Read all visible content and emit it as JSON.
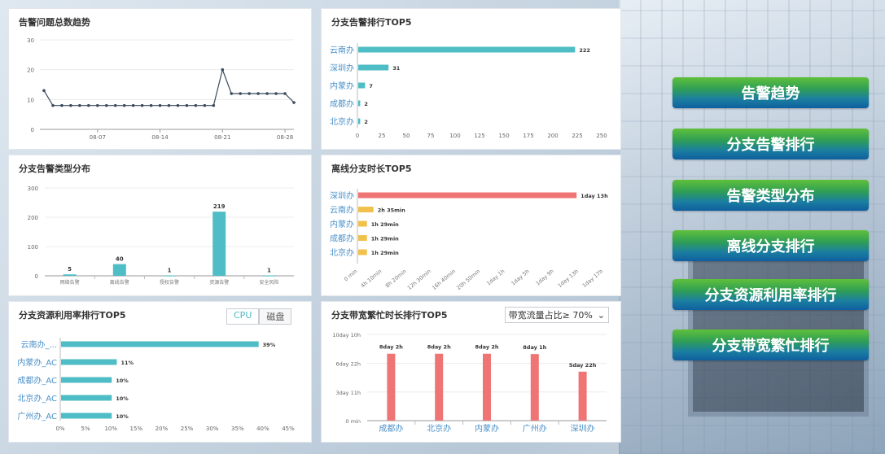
{
  "panels": {
    "trend": {
      "title": "告警问题总数趋势",
      "chart_data": {
        "type": "line",
        "y_ticks": [
          0,
          10,
          20,
          30
        ],
        "ylim": [
          0,
          30
        ],
        "x_tick_labels": [
          "08-07",
          "08-14",
          "08-21",
          "08-28"
        ],
        "x_tick_index": [
          6,
          13,
          20,
          27
        ],
        "values": [
          13,
          8,
          8,
          8,
          8,
          8,
          8,
          8,
          8,
          8,
          8,
          8,
          8,
          8,
          8,
          8,
          8,
          8,
          8,
          8,
          20,
          12,
          12,
          12,
          12,
          12,
          12,
          12,
          9
        ],
        "color": "#3a4a5e"
      }
    },
    "branch_alarm": {
      "title": "分支告警排行TOP5",
      "chart_data": {
        "type": "bar",
        "orientation": "horizontal",
        "categories": [
          "云南办",
          "深圳办",
          "内蒙办",
          "成都办",
          "北京办"
        ],
        "values": [
          222,
          31,
          7,
          2,
          2
        ],
        "value_labels": [
          "222",
          "31",
          "7",
          "2",
          "2"
        ],
        "x_ticks": [
          0,
          25,
          50,
          75,
          100,
          125,
          150,
          175,
          200,
          225,
          250
        ],
        "xlim": [
          0,
          250
        ],
        "color": "#4fbdc5"
      }
    },
    "alarm_type": {
      "title": "分支告警类型分布",
      "chart_data": {
        "type": "bar",
        "categories": [
          "网络告警",
          "离线告警",
          "授权告警",
          "资源告警",
          "安全风险"
        ],
        "values": [
          5,
          40,
          1,
          219,
          1
        ],
        "value_labels": [
          "5",
          "40",
          "1",
          "219",
          "1"
        ],
        "y_ticks": [
          0,
          100,
          200,
          300
        ],
        "ylim": [
          0,
          300
        ],
        "color": "#4fbdc5"
      }
    },
    "offline": {
      "title": "离线分支时长TOP5",
      "chart_data": {
        "type": "bar",
        "orientation": "horizontal",
        "categories": [
          "深圳办",
          "云南办",
          "内蒙办",
          "成都办",
          "北京办"
        ],
        "values_hours": [
          37,
          2.58,
          1.48,
          1.48,
          1.48
        ],
        "value_labels": [
          "1day 13h",
          "2h 35min",
          "1h 29min",
          "1h 29min",
          "1h 29min"
        ],
        "colors": [
          "#ef7474",
          "#f0c24b",
          "#f0c24b",
          "#f0c24b",
          "#f0c24b"
        ],
        "x_tick_labels": [
          "0 min",
          "4h 10min",
          "8h 20min",
          "12h 30min",
          "16h 40min",
          "20h 50min",
          "1day 1h",
          "1day 5h",
          "1day 9h",
          "1day 13h",
          "1day 17h"
        ],
        "x_tick_hours": [
          0,
          4.1667,
          8.3333,
          12.5,
          16.6667,
          20.8333,
          25,
          29.1667,
          33.3333,
          37.5,
          41.6667
        ],
        "xlim_hours": [
          0,
          41.6667
        ]
      }
    },
    "resource": {
      "title": "分支资源利用率排行TOP5",
      "toggle": {
        "cpu": "CPU",
        "disk": "磁盘"
      },
      "chart_data": {
        "type": "bar",
        "orientation": "horizontal",
        "categories": [
          "云南办_...",
          "内蒙办_AC",
          "成都办_AC",
          "北京办_AC",
          "广州办_AC"
        ],
        "values": [
          39,
          11,
          10,
          10,
          10
        ],
        "value_labels": [
          "39%",
          "11%",
          "10%",
          "10%",
          "10%"
        ],
        "x_tick_labels": [
          "0%",
          "5%",
          "10%",
          "15%",
          "20%",
          "25%",
          "30%",
          "35%",
          "40%",
          "45%"
        ],
        "xlim": [
          0,
          45
        ],
        "color": "#4fbdc5"
      }
    },
    "bandwidth": {
      "title": "分支带宽繁忙时长排行TOP5",
      "select": {
        "value": "带宽流量占比≥ 70%",
        "arrow": "⌄"
      },
      "chart_data": {
        "type": "bar",
        "categories": [
          "成都办",
          "北京办",
          "内蒙办",
          "广州办",
          "深圳办"
        ],
        "values_hours": [
          194,
          194,
          194,
          193,
          142
        ],
        "value_labels": [
          "8day 2h",
          "8day 2h",
          "8day 2h",
          "8day 1h",
          "5day 22h"
        ],
        "y_tick_labels": [
          "0 min",
          "3day 11h",
          "6day 22h",
          "10day 10h"
        ],
        "y_tick_hours": [
          0,
          83,
          166,
          250
        ],
        "ylim_hours": [
          0,
          250
        ],
        "color": "#ef7474"
      }
    }
  },
  "nav_buttons": [
    "告警趋势",
    "分支告警排行",
    "告警类型分布",
    "离线分支排行",
    "分支资源利用率排行",
    "分支带宽繁忙排行"
  ]
}
